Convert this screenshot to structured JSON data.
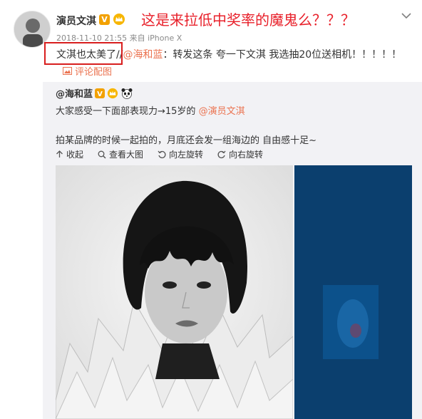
{
  "header": {
    "author_name": "演员文淇",
    "verified_mark": "V",
    "annotation": "这是来拉低中奖率的魔鬼么？？？",
    "meta": "2018-11-10 21:55 来自 iPhone X",
    "text_start": "文淇也太美了//",
    "mention": "@海和蓝",
    "text_end": "：转发这条  夸一下文淇  我选抽20位送相机！！！！！",
    "comment_pic_label": "评论配图"
  },
  "repost": {
    "author": "@海和蓝",
    "line1_start": "大家感受一下面部表现力→15岁的 ",
    "line1_mention": "@演员文淇",
    "line2": "拍某品牌的时候一起拍的，月底还会发一组海边的 自由感十足~"
  },
  "toolbar": {
    "collapse": "收起",
    "view_large": "查看大图",
    "rotate_left": "向左旋转",
    "rotate_right": "向右旋转"
  },
  "colors": {
    "accent": "#eb7350",
    "annotation_red": "#e8202a",
    "card_bg": "#f2f2f5",
    "side_photo_blue": "#0b3f6e"
  }
}
